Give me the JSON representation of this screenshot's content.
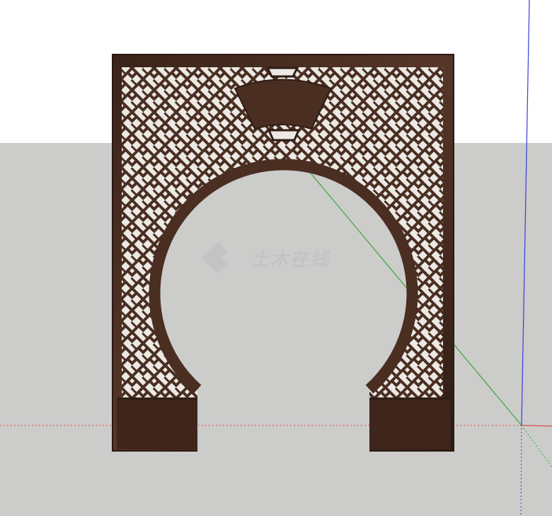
{
  "scene": {
    "sky_color": "#ffffff",
    "ground_color": "#cccccb",
    "x_axis_color": "#e04848",
    "y_axis_color": "#3aa53a",
    "z_axis_color": "#3a3ae0"
  },
  "model": {
    "name": "moon-gate-lattice-screen",
    "wood_color": "#4a2e22",
    "wood_dark_color": "#2f1c14",
    "lattice_opening_color": "#ece9e4"
  },
  "watermark": {
    "text": "土木在线",
    "color": "#bdbdbd"
  }
}
